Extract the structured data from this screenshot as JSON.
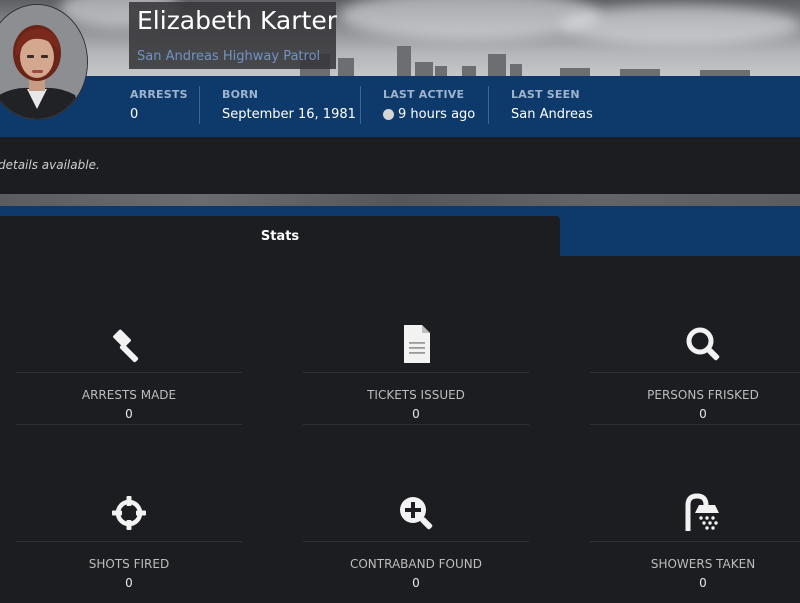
{
  "profile": {
    "name": "Elizabeth Karter",
    "agency": "San Andreas Highway Patrol"
  },
  "info_bar": {
    "arrests": {
      "label": "ARRESTS",
      "value": "0"
    },
    "born": {
      "label": "BORN",
      "value": "September 16, 1981"
    },
    "last_active": {
      "label": "LAST ACTIVE",
      "value": "9 hours ago",
      "status_color": "#d6d6d6"
    },
    "last_seen": {
      "label": "LAST SEEN",
      "value": "San Andreas"
    }
  },
  "details": {
    "text": "details available."
  },
  "tabs": {
    "stats_label": "Stats"
  },
  "stats": [
    {
      "label": "ARRESTS MADE",
      "value": "0",
      "icon": "gavel-icon"
    },
    {
      "label": "TICKETS ISSUED",
      "value": "0",
      "icon": "document-icon"
    },
    {
      "label": "PERSONS FRISKED",
      "value": "0",
      "icon": "search-icon"
    },
    {
      "label": "SHOTS FIRED",
      "value": "0",
      "icon": "crosshairs-icon"
    },
    {
      "label": "CONTRABAND FOUND",
      "value": "0",
      "icon": "zoom-in-icon"
    },
    {
      "label": "SHOWERS TAKEN",
      "value": "0",
      "icon": "shower-icon"
    }
  ],
  "colors": {
    "banner_bar": "#0e3a6b",
    "background": "#1c1d20",
    "agency_link": "#6f93c4"
  }
}
